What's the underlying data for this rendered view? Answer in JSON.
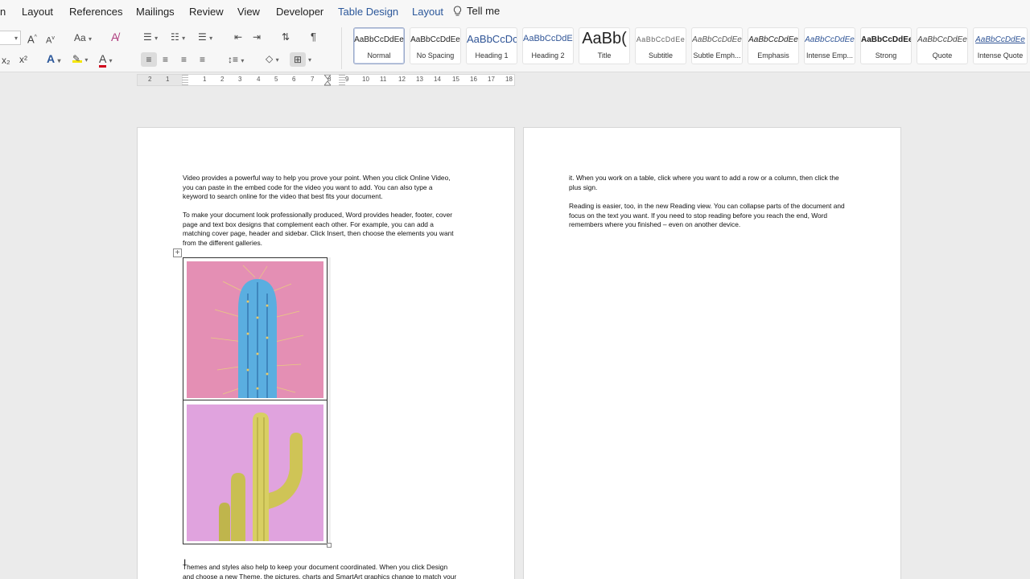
{
  "menu": {
    "items": [
      "n",
      "Layout",
      "References",
      "Mailings",
      "Review",
      "View",
      "Developer",
      "Table Design",
      "Layout"
    ],
    "tell_me": "Tell me"
  },
  "ribbon": {
    "change_case": "Aa",
    "subscript": "x₂",
    "superscript": "x²",
    "text_effects": "A",
    "font_color": "A"
  },
  "styles": [
    {
      "preview": "AaBbCcDdEe",
      "name": "Normal"
    },
    {
      "preview": "AaBbCcDdEe",
      "name": "No Spacing"
    },
    {
      "preview": "AaBbCcDc",
      "name": "Heading 1"
    },
    {
      "preview": "AaBbCcDdEe",
      "name": "Heading 2"
    },
    {
      "preview": "AaBb(",
      "name": "Title"
    },
    {
      "preview": "AaBbCcDdEe",
      "name": "Subtitle"
    },
    {
      "preview": "AaBbCcDdEe",
      "name": "Subtle Emph..."
    },
    {
      "preview": "AaBbCcDdEe",
      "name": "Emphasis"
    },
    {
      "preview": "AaBbCcDdEe",
      "name": "Intense Emp..."
    },
    {
      "preview": "AaBbCcDdEe",
      "name": "Strong"
    },
    {
      "preview": "AaBbCcDdEe",
      "name": "Quote"
    },
    {
      "preview": "AaBbCcDdEe",
      "name": "Intense Quote"
    }
  ],
  "ruler": {
    "numbers": [
      "2",
      "1",
      "1",
      "2",
      "3",
      "4",
      "5",
      "6",
      "7",
      "8",
      "9",
      "10",
      "11",
      "12",
      "13",
      "14",
      "15",
      "16",
      "17",
      "18"
    ]
  },
  "page1": {
    "p1": [
      "Video provides a powerful way to help you prove your point. When you click Online Video,",
      "you can paste in the embed code for the video you want to add. You can also type a",
      "keyword to search online for the video that best fits your document."
    ],
    "p2": [
      "To make your document look professionally produced, Word provides header, footer, cover",
      "page and text box designs that complement each other. For example, you can add a",
      "matching cover page, header and sidebar. Click Insert, then choose the elements you want",
      "from the different galleries."
    ],
    "p3": [
      "Themes and styles also help to keep your document coordinated. When you click Design",
      "and choose a new Theme, the pictures, charts and SmartArt graphics change to match your"
    ]
  },
  "page2": {
    "p1": [
      "it. When you work on a table, click where you want to add a row or a column, then click the",
      "plus sign."
    ],
    "p2": [
      "Reading is easier, too, in the new Reading view. You can collapse parts of the document and",
      "focus on the text you want. If you need to stop reading before you reach the end, Word",
      "remembers where you finished – even on another device."
    ]
  },
  "colors": {
    "accent": "#2b579a",
    "cactus_bg_1": "#e48fb4",
    "cactus_bg_2": "#e0a3de",
    "cactus_blue": "#5aaee0",
    "cactus_yellow": "#d8cf62"
  }
}
